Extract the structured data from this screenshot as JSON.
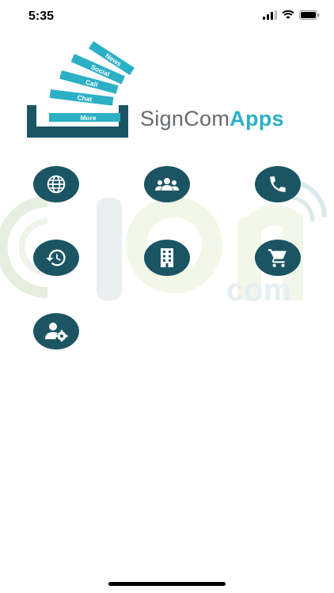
{
  "status_bar": {
    "time": "5:35"
  },
  "logo": {
    "stripes": [
      "News",
      "Social",
      "Call",
      "Chat",
      "More"
    ],
    "brand_part1": "SignCom",
    "brand_part2": "Apps",
    "colors": {
      "teal_dark": "#1b5563",
      "cyan": "#2bb0c6",
      "gray": "#666a6d"
    }
  },
  "watermark": {
    "letters": "Sign",
    "suffix": "com"
  },
  "grid_buttons": [
    {
      "icon": "globe-icon"
    },
    {
      "icon": "group-icon"
    },
    {
      "icon": "phone-icon"
    },
    {
      "icon": "history-icon"
    },
    {
      "icon": "building-icon"
    },
    {
      "icon": "cart-icon"
    },
    {
      "icon": "user-settings-icon"
    }
  ]
}
